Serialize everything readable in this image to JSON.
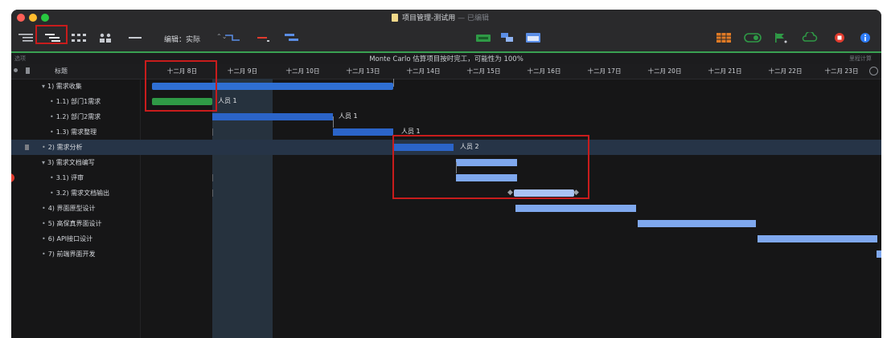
{
  "window": {
    "title": "项目管理-测试用",
    "title_suffix": "— 已编辑",
    "traffic_colors": [
      "#fe5f57",
      "#febc2e",
      "#28c840"
    ]
  },
  "toolbar": {
    "left_icons": [
      "outline-icon",
      "gantt-view-icon",
      "network-icon",
      "resource-icon",
      "split-icon"
    ],
    "edit_mode_label": "编辑：实际",
    "edit_mode_arrows": "⌃⌄",
    "middle_icons": [
      "connect-icon",
      "minus-icon",
      "level-icon"
    ],
    "center_icons": [
      "baseline-icon",
      "share-icon",
      "calendar-icon"
    ],
    "right_icons": [
      "table-icon",
      "toggle-icon",
      "flag-icon",
      "cloud-icon",
      "stop-icon",
      "info-icon"
    ]
  },
  "infobar": {
    "left_text": "选项",
    "message": "Monte Carlo 估算项目按时完工，可能性为 100%",
    "right_text": "里程计算"
  },
  "header": {
    "title_col": "标题",
    "dates": [
      "十二月 8日",
      "十二月 9日",
      "十二月 10日",
      "十二月 13日",
      "十二月 14日",
      "十二月 15日",
      "十二月 16日",
      "十二月 17日",
      "十二月 20日",
      "十二月 21日",
      "十二月 22日",
      "十二月 23日"
    ]
  },
  "tasks": [
    {
      "label": "1) 需求收集",
      "resource": ""
    },
    {
      "label": "1.1) 部门1需求",
      "resource": "人员 1"
    },
    {
      "label": "1.2) 部门2需求",
      "resource": "人员 1"
    },
    {
      "label": "1.3) 需求整理",
      "resource": "人员 1"
    },
    {
      "label": "2) 需求分析",
      "resource": "人员 2"
    },
    {
      "label": "3) 需求文档编写",
      "resource": ""
    },
    {
      "label": "3.1) 评审",
      "resource": ""
    },
    {
      "label": "3.2) 需求文档输出",
      "resource": ""
    },
    {
      "label": "4) 界面原型设计",
      "resource": ""
    },
    {
      "label": "5) 高保真界面设计",
      "resource": ""
    },
    {
      "label": "6) API接口设计",
      "resource": ""
    },
    {
      "label": "7) 前端界面开发",
      "resource": ""
    }
  ],
  "colors": {
    "accent_green": "#3aa152",
    "summary_bar": "#2f6fd3",
    "task_bar": "#2b64c8",
    "light_bar": "#7fa8ee",
    "selection": "#263447",
    "highlight": "#c81c1c"
  }
}
